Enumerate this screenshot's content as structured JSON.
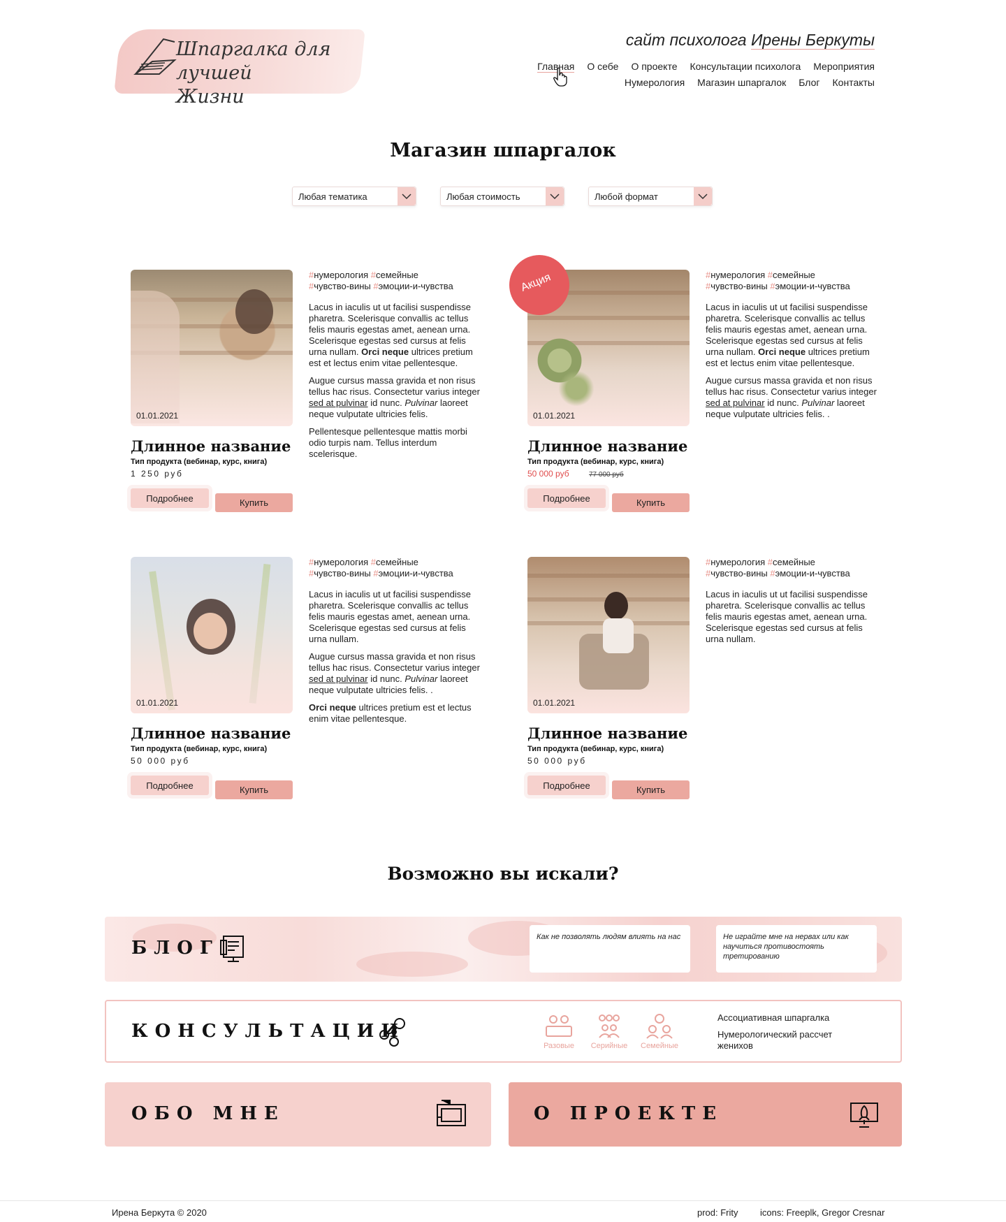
{
  "header": {
    "logo_text_line1": "Шпаргалка для лучшей",
    "logo_text_line2": "Жизни",
    "tagline_prefix": "сайт психолога",
    "tagline_name": "Ирены Беркуты",
    "nav_row1": [
      "Главная",
      "О себе",
      "О проекте",
      "Консультации психолога",
      "Мероприятия"
    ],
    "nav_row2": [
      "Нумерология",
      "Магазин шпаргалок",
      "Блог",
      "Контакты"
    ]
  },
  "shop": {
    "title": "Магазин шпаргалок",
    "filters": [
      "Любая тематика",
      "Любая стоимость",
      "Любой формат"
    ]
  },
  "products": [
    {
      "date": "01.01.2021",
      "title": "Длинное название",
      "type": "Тип продукта (вебинар, курс, книга)",
      "price": "1 250 руб",
      "old_price": "",
      "more_label": "Подробнее",
      "buy_label": "Купить",
      "tags_line1": [
        "нумерология",
        "семейные"
      ],
      "tags_line2": [
        "чувство-вины",
        "эмоции-и-чувства"
      ],
      "p1": "Lacus in iaculis ut ut facilisi suspendisse pharetra. Scelerisque convallis ac tellus felis mauris egestas amet, aenean urna. Scelerisque egestas sed cursus at felis urna nullam.",
      "p1_bold": "Orci neque",
      "p1_end": "ultrices pretium est et lectus enim vitae pellentesque.",
      "p2_start": "Augue cursus massa gravida et non risus tellus hac risus. Consectetur varius integer",
      "p2_link": "sed at pulvinar",
      "p2_mid": "id nunc.",
      "p2_ital": "Pulvinar",
      "p2_end": "laoreet neque vulputate ultricies felis.",
      "p3": "Pellentesque pellentesque mattis morbi odio turpis nam. Tellus interdum scelerisque."
    },
    {
      "date": "01.01.2021",
      "title": "Длинное название",
      "type": "Тип продукта (вебинар, курс, книга)",
      "price": "50 000 руб",
      "old_price": "77 000 руб",
      "badge": "Акция",
      "more_label": "Подробнее",
      "buy_label": "Купить",
      "tags_line1": [
        "нумерология",
        "семейные"
      ],
      "tags_line2": [
        "чувство-вины",
        "эмоции-и-чувства"
      ],
      "p1": "Lacus in iaculis ut ut facilisi suspendisse pharetra. Scelerisque convallis ac tellus felis mauris egestas amet, aenean urna. Scelerisque egestas sed cursus at felis urna nullam.",
      "p1_bold": "Orci neque",
      "p1_end": "ultrices pretium est et lectus enim vitae pellentesque.",
      "p2_start": "Augue cursus massa gravida et non risus tellus hac risus. Consectetur varius integer",
      "p2_link": "sed at pulvinar",
      "p2_mid": "id nunc.",
      "p2_ital": "Pulvinar",
      "p2_end": "laoreet neque vulputate ultricies felis. ."
    },
    {
      "date": "01.01.2021",
      "title": "Длинное название",
      "type": "Тип продукта (вебинар, курс, книга)",
      "price": "50 000 руб",
      "old_price": "",
      "more_label": "Подробнее",
      "buy_label": "Купить",
      "tags_line1": [
        "нумерология",
        "семейные"
      ],
      "tags_line2": [
        "чувство-вины",
        "эмоции-и-чувства"
      ],
      "p1": "Lacus in iaculis ut ut facilisi suspendisse pharetra. Scelerisque convallis ac tellus felis mauris egestas amet, aenean urna. Scelerisque egestas sed cursus at felis urna nullam.",
      "p2_start": "Augue cursus massa gravida et non risus tellus hac risus. Consectetur varius integer",
      "p2_link": "sed at pulvinar",
      "p2_mid": "id nunc.",
      "p2_ital": "Pulvinar",
      "p2_end": "laoreet neque vulputate ultricies felis. .",
      "p3_bold": "Orci neque",
      "p3_end": "ultrices pretium est et lectus enim vitae pellentesque."
    },
    {
      "date": "01.01.2021",
      "title": "Длинное название",
      "type": "Тип продукта (вебинар, курс, книга)",
      "price": "50 000 руб",
      "old_price": "",
      "more_label": "Подробнее",
      "buy_label": "Купить",
      "tags_line1": [
        "нумерология",
        "семейные"
      ],
      "tags_line2": [
        "чувство-вины",
        "эмоции-и-чувства"
      ],
      "p1": "Lacus in iaculis ut ut facilisi suspendisse pharetra. Scelerisque convallis ac tellus felis mauris egestas amet, aenean urna. Scelerisque egestas sed cursus at felis urna nullam."
    }
  ],
  "related": {
    "title": "Возможно вы искали?",
    "blog": {
      "label": "БЛОГ",
      "icon": "document-icon",
      "posts": [
        "Как не позволять людям влиять на нас",
        "Не играйте мне на нервах или как научиться противостоять третированию"
      ]
    },
    "consult": {
      "label": "КОНСУЛЬТАЦИИ",
      "icon": "network-icon",
      "types": [
        "Разовые",
        "Серийные",
        "Семейные"
      ],
      "links": [
        "Ассоциативная шпаргалка",
        "Нумерологический рассчет женихов"
      ]
    },
    "about": {
      "label": "ОБО МНЕ",
      "icon": "monitor-icon"
    },
    "project": {
      "label": "О ПРОЕКТЕ",
      "icon": "rocket-icon"
    }
  },
  "footer": {
    "copyright": "Ирена Беркута © 2020",
    "prod": "prod: Frity",
    "icons": "icons: Freeplk, Gregor Cresnar"
  },
  "colors": {
    "accent": "#eba89f",
    "light_pink": "#f6d1cd",
    "tag_hash": "#e8928a",
    "sale": "#e65a5d"
  }
}
